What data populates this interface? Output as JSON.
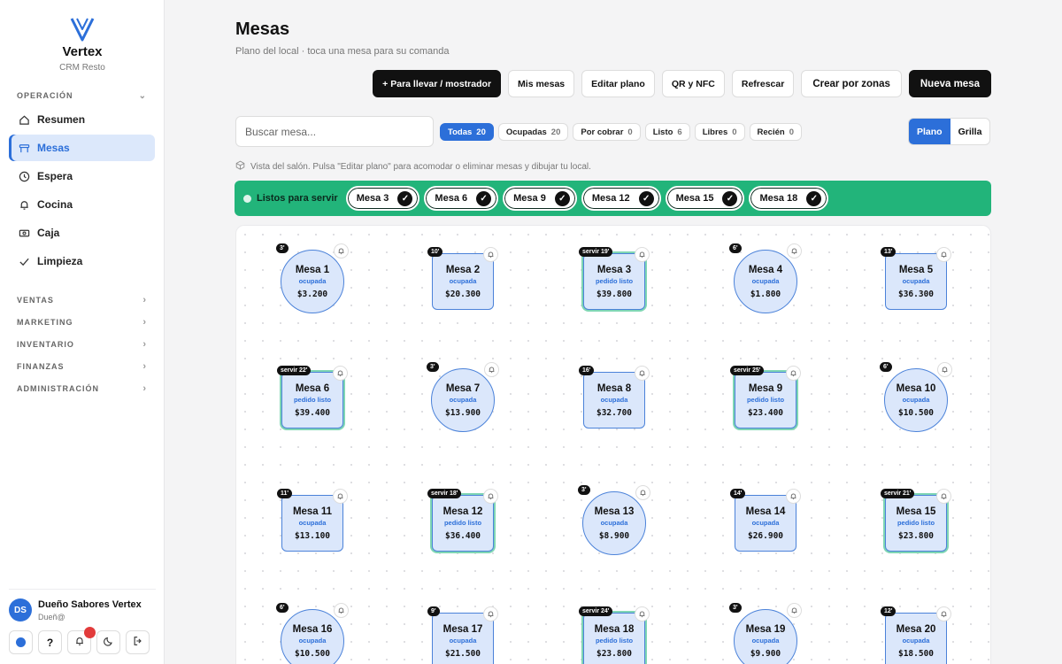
{
  "brand": {
    "name": "Vertex",
    "subtitle": "CRM Resto"
  },
  "nav": {
    "section": "OPERACIÓN",
    "items": [
      {
        "label": "Resumen",
        "icon": "home-icon",
        "active": false
      },
      {
        "label": "Mesas",
        "icon": "table-icon",
        "active": true
      },
      {
        "label": "Espera",
        "icon": "clock-icon",
        "active": false
      },
      {
        "label": "Cocina",
        "icon": "bell-icon",
        "active": false
      },
      {
        "label": "Caja",
        "icon": "cash-icon",
        "active": false
      },
      {
        "label": "Limpieza",
        "icon": "check-icon",
        "active": false
      }
    ],
    "groups": [
      "VENTAS",
      "MARKETING",
      "INVENTARIO",
      "FINANZAS",
      "ADMINISTRACIÓN"
    ]
  },
  "user": {
    "initials": "DS",
    "name": "Dueño Sabores Vertex",
    "role": "Dueñ@"
  },
  "page": {
    "title": "Mesas",
    "subtitle": "Plano del local · toca una mesa para su comanda"
  },
  "toolbar": {
    "takeaway": "+ Para llevar / mostrador",
    "my_tables": "Mis mesas",
    "edit_plan": "Editar plano",
    "qr_nfc": "QR y NFC",
    "refresh": "Refrescar",
    "create_zones": "Crear por zonas",
    "new_table": "Nueva mesa"
  },
  "search": {
    "placeholder": "Buscar mesa..."
  },
  "filters": [
    {
      "label": "Todas",
      "count": "20",
      "active": true
    },
    {
      "label": "Ocupadas",
      "count": "20",
      "active": false
    },
    {
      "label": "Por cobrar",
      "count": "0",
      "active": false
    },
    {
      "label": "Listo",
      "count": "6",
      "active": false
    },
    {
      "label": "Libres",
      "count": "0",
      "active": false
    },
    {
      "label": "Recién",
      "count": "0",
      "active": false
    }
  ],
  "view": {
    "plan": "Plano",
    "grid": "Grilla",
    "active": "Plano"
  },
  "hint": "Vista del salón. Pulsa \"Editar plano\" para acomodar o eliminar mesas y dibujar tu local.",
  "ready": {
    "title": "Listos para servir",
    "tables": [
      "Mesa 3",
      "Mesa 6",
      "Mesa 9",
      "Mesa 12",
      "Mesa 15",
      "Mesa 18"
    ]
  },
  "colors": {
    "accent": "#2c6fd9",
    "ready": "#22b47a",
    "table_fill": "#dbe7fb"
  },
  "tables": [
    {
      "name": "Mesa 1",
      "status": "ocupada",
      "total": "$3.200",
      "timer": "3'",
      "shape": "round",
      "ready": false
    },
    {
      "name": "Mesa 2",
      "status": "ocupada",
      "total": "$20.300",
      "timer": "10'",
      "shape": "square",
      "ready": false
    },
    {
      "name": "Mesa 3",
      "status": "pedido listo",
      "total": "$39.800",
      "timer": "servir 19'",
      "shape": "square",
      "ready": true
    },
    {
      "name": "Mesa 4",
      "status": "ocupada",
      "total": "$1.800",
      "timer": "6'",
      "shape": "round",
      "ready": false
    },
    {
      "name": "Mesa 5",
      "status": "ocupada",
      "total": "$36.300",
      "timer": "13'",
      "shape": "square",
      "ready": false
    },
    {
      "name": "Mesa 6",
      "status": "pedido listo",
      "total": "$39.400",
      "timer": "servir 22'",
      "shape": "square",
      "ready": true
    },
    {
      "name": "Mesa 7",
      "status": "ocupada",
      "total": "$13.900",
      "timer": "3'",
      "shape": "round",
      "ready": false
    },
    {
      "name": "Mesa 8",
      "status": "ocupada",
      "total": "$32.700",
      "timer": "16'",
      "shape": "square",
      "ready": false
    },
    {
      "name": "Mesa 9",
      "status": "pedido listo",
      "total": "$23.400",
      "timer": "servir 25'",
      "shape": "square",
      "ready": true
    },
    {
      "name": "Mesa 10",
      "status": "ocupada",
      "total": "$10.500",
      "timer": "6'",
      "shape": "round",
      "ready": false
    },
    {
      "name": "Mesa 11",
      "status": "ocupada",
      "total": "$13.100",
      "timer": "11'",
      "shape": "square",
      "ready": false
    },
    {
      "name": "Mesa 12",
      "status": "pedido listo",
      "total": "$36.400",
      "timer": "servir 18'",
      "shape": "square",
      "ready": true
    },
    {
      "name": "Mesa 13",
      "status": "ocupada",
      "total": "$8.900",
      "timer": "3'",
      "shape": "round",
      "ready": false
    },
    {
      "name": "Mesa 14",
      "status": "ocupada",
      "total": "$26.900",
      "timer": "14'",
      "shape": "square",
      "ready": false
    },
    {
      "name": "Mesa 15",
      "status": "pedido listo",
      "total": "$23.800",
      "timer": "servir 21'",
      "shape": "square",
      "ready": true
    },
    {
      "name": "Mesa 16",
      "status": "ocupada",
      "total": "$10.500",
      "timer": "6'",
      "shape": "round",
      "ready": false
    },
    {
      "name": "Mesa 17",
      "status": "ocupada",
      "total": "$21.500",
      "timer": "9'",
      "shape": "square",
      "ready": false
    },
    {
      "name": "Mesa 18",
      "status": "pedido listo",
      "total": "$23.800",
      "timer": "servir 24'",
      "shape": "square",
      "ready": true
    },
    {
      "name": "Mesa 19",
      "status": "ocupada",
      "total": "$9.900",
      "timer": "3'",
      "shape": "round",
      "ready": false
    },
    {
      "name": "Mesa 20",
      "status": "ocupada",
      "total": "$18.500",
      "timer": "12'",
      "shape": "square",
      "ready": false
    }
  ]
}
